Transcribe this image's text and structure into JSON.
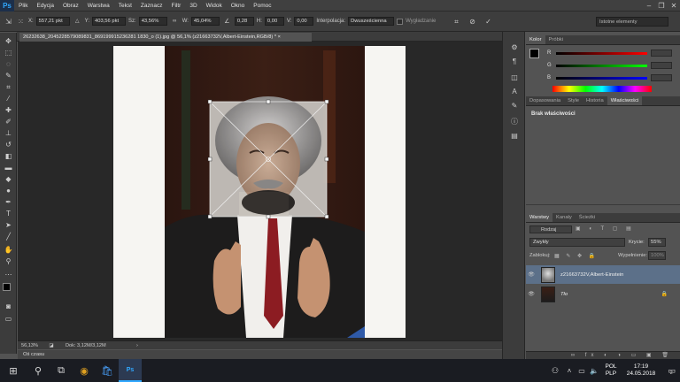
{
  "app": {
    "logo": "Ps"
  },
  "menu": [
    "Plik",
    "Edycja",
    "Obraz",
    "Warstwa",
    "Tekst",
    "Zaznacz",
    "Filtr",
    "3D",
    "Widok",
    "Okno",
    "Pomoc"
  ],
  "window_controls": [
    "–",
    "❐",
    "✕"
  ],
  "options": {
    "x_label": "X:",
    "x_value": "557,21 pkt",
    "y_label": "Y:",
    "y_value": "403,56 pkt",
    "w_label": "Sz:",
    "w_value": "43,56%",
    "h_label": "W:",
    "h_value": "45,04%",
    "angle_value": "0,28",
    "h_skew_label": "H:",
    "h_skew_value": "0,00",
    "v_skew_label": "V:",
    "v_skew_value": "0,00",
    "interp_label": "Interpolacja:",
    "interp_value": "Dwusześcienna",
    "smooth_label": "Wygładzanie",
    "workspace": "Istotne elementy"
  },
  "document": {
    "tab_title": "26232638_2045228579089831_869199915236281 1830_o (1).jpg @ 56,1% (z21663732V,Albert-Einstein,RGB/8) *",
    "tab_close": "×"
  },
  "status": {
    "zoom": "56,13%",
    "doc_info": "Dok: 3,12M/3,12M"
  },
  "timeline_label": "Oś czasu",
  "color_panel": {
    "tabs": [
      "Kolor",
      "Próbki"
    ],
    "channels": [
      {
        "label": "R",
        "value": "0"
      },
      {
        "label": "G",
        "value": "0"
      },
      {
        "label": "B",
        "value": "0"
      }
    ]
  },
  "adjust_panel": {
    "tabs": [
      "Dopasowania",
      "Style",
      "Historia",
      "Właściwości"
    ],
    "empty_text": "Brak właściwości"
  },
  "layers_panel": {
    "tabs": [
      "Warstwy",
      "Kanały",
      "Ścieżki"
    ],
    "filter_label": "Rodzaj",
    "blend_mode": "Zwykły",
    "opacity_label": "Krycie:",
    "opacity_value": "55%",
    "lock_label": "Zablokuj:",
    "fill_label": "Wypełnienie:",
    "fill_value": "100%",
    "layers": [
      {
        "name": "z21663732V,Albert-Einstein",
        "selected": true
      },
      {
        "name": "Tło",
        "selected": false
      }
    ]
  },
  "taskbar": {
    "lang_top": "POL",
    "lang_bottom": "PLP",
    "time": "17:19",
    "date": "24.05.2018",
    "notif_count": "2"
  },
  "colors": {
    "accent": "#31a8ff",
    "selected_layer": "#5c7089",
    "panel": "#535353"
  }
}
